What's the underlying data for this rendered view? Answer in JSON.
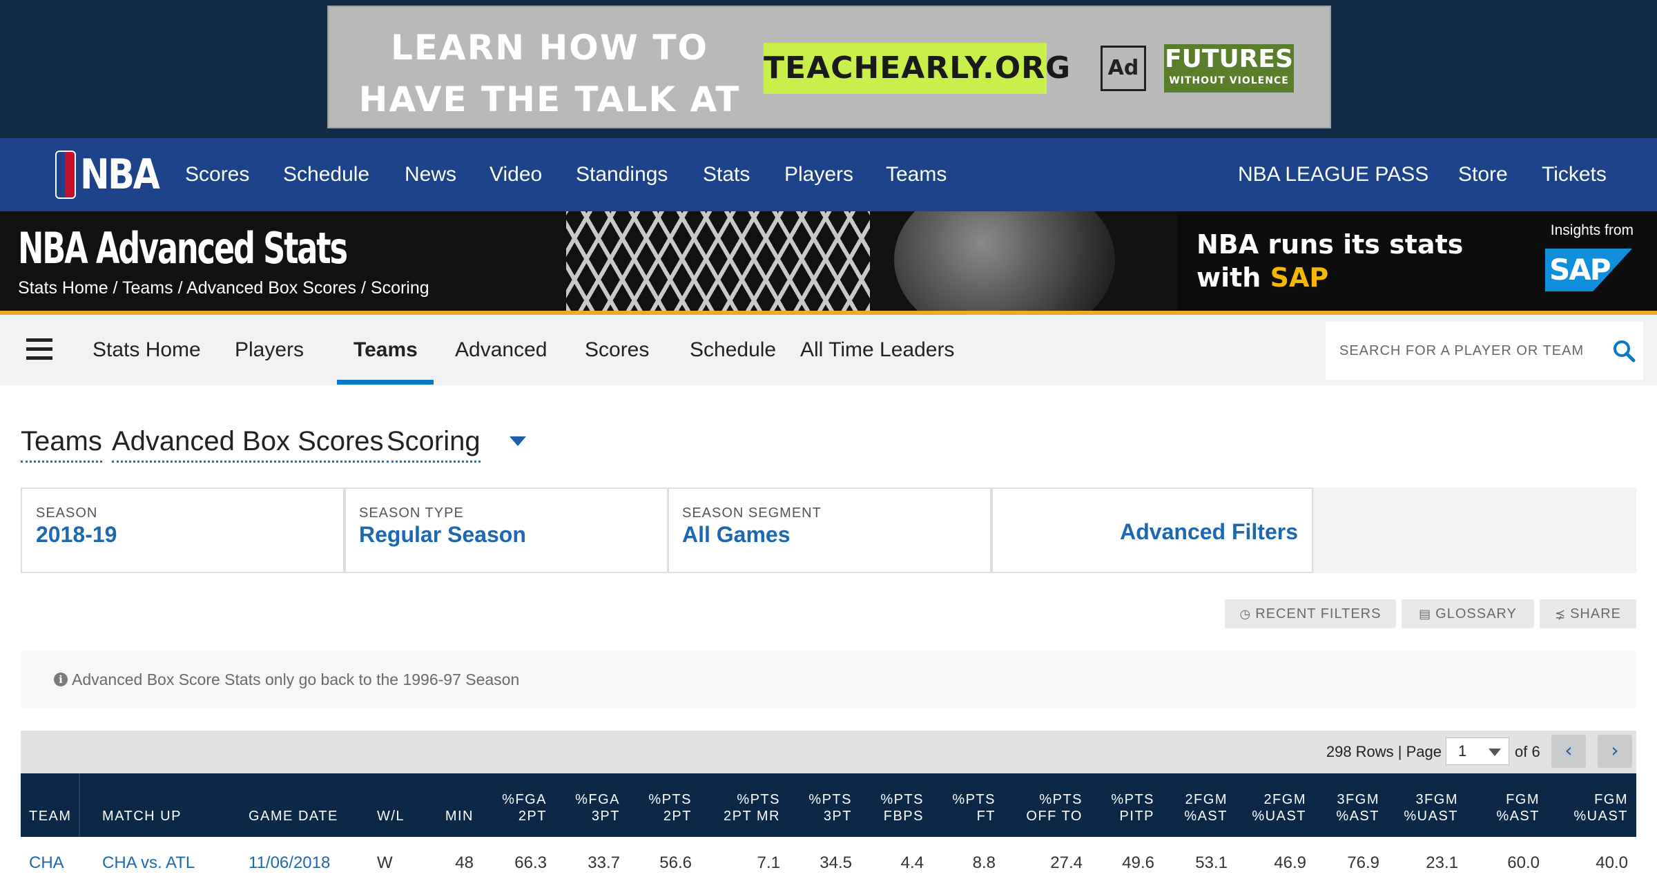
{
  "ad": {
    "headline_line1": "LEARN HOW TO",
    "headline_line2": "HAVE THE TALK AT",
    "url": "TEACHEARLY.ORG",
    "council": "Ad Council",
    "futures": "FUTURES",
    "futures_sub": "WITHOUT VIOLENCE"
  },
  "nav": {
    "logo": "NBA",
    "items": [
      "Scores",
      "Schedule",
      "News",
      "Video",
      "Standings",
      "Stats",
      "Players",
      "Teams"
    ],
    "right_items": [
      "NBA LEAGUE PASS",
      "Store",
      "Tickets"
    ]
  },
  "hero": {
    "title": "NBA Advanced Stats",
    "breadcrumb": "Stats Home / Teams / Advanced Box Scores / Scoring",
    "sap_line1": "NBA runs its stats",
    "sap_line2_prefix": "with ",
    "sap_line2_highlight": "SAP",
    "sap_insights": "Insights from",
    "sap_logo": "SAP"
  },
  "subnav": {
    "items": [
      "Stats Home",
      "Players",
      "Teams",
      "Advanced",
      "Scores",
      "Schedule",
      "All Time Leaders"
    ],
    "active": "Teams",
    "search_placeholder": "SEARCH FOR A PLAYER OR TEAM"
  },
  "page_title": {
    "part1": "Teams",
    "part2": "Advanced Box Scores",
    "part3": "Scoring"
  },
  "filters": [
    {
      "label": "SEASON",
      "value": "2018-19"
    },
    {
      "label": "SEASON TYPE",
      "value": "Regular Season"
    },
    {
      "label": "SEASON SEGMENT",
      "value": "All Games"
    }
  ],
  "advanced_filters": "Advanced Filters",
  "tools": {
    "recent": "RECENT FILTERS",
    "glossary": "GLOSSARY",
    "share": "SHARE"
  },
  "note": "Advanced Box Score Stats only go back to the 1996-97 Season",
  "pager": {
    "rows": "298 Rows | Page",
    "page": "1",
    "of": "of 6"
  },
  "table": {
    "headers": [
      {
        "l1": "",
        "l2": "TEAM"
      },
      {
        "l1": "",
        "l2": "MATCH UP"
      },
      {
        "l1": "",
        "l2": "GAME DATE"
      },
      {
        "l1": "",
        "l2": "W/L"
      },
      {
        "l1": "",
        "l2": "MIN"
      },
      {
        "l1": "%FGA",
        "l2": "2PT"
      },
      {
        "l1": "%FGA",
        "l2": "3PT"
      },
      {
        "l1": "%PTS",
        "l2": "2PT"
      },
      {
        "l1": "%PTS",
        "l2": "2PT MR"
      },
      {
        "l1": "%PTS",
        "l2": "3PT"
      },
      {
        "l1": "%PTS",
        "l2": "FBPS"
      },
      {
        "l1": "%PTS",
        "l2": "FT"
      },
      {
        "l1": "%PTS",
        "l2": "OFF TO"
      },
      {
        "l1": "%PTS",
        "l2": "PITP"
      },
      {
        "l1": "2FGM",
        "l2": "%AST"
      },
      {
        "l1": "2FGM",
        "l2": "%UAST"
      },
      {
        "l1": "3FGM",
        "l2": "%AST"
      },
      {
        "l1": "3FGM",
        "l2": "%UAST"
      },
      {
        "l1": "FGM",
        "l2": "%AST"
      },
      {
        "l1": "FGM",
        "l2": "%UAST"
      }
    ],
    "rows": [
      [
        "CHA",
        "CHA vs. ATL",
        "11/06/2018",
        "W",
        "48",
        "66.3",
        "33.7",
        "56.6",
        "7.1",
        "34.5",
        "4.4",
        "8.8",
        "27.4",
        "49.6",
        "53.1",
        "46.9",
        "76.9",
        "23.1",
        "60.0",
        "40.0"
      ]
    ]
  }
}
